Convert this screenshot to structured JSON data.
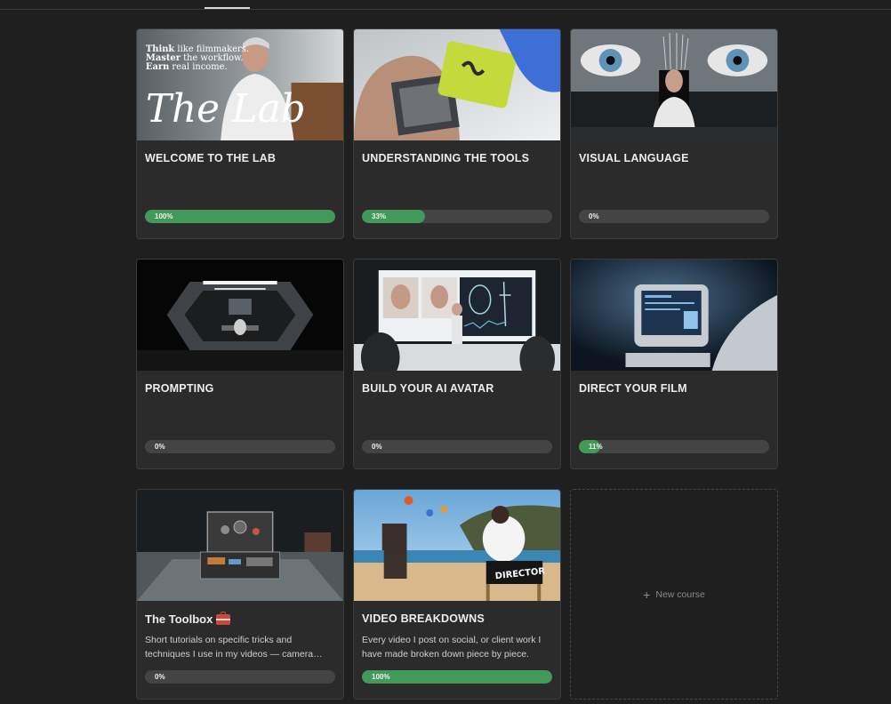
{
  "colors": {
    "background": "#1f1f1f",
    "card": "#2b2b2b",
    "progress_track": "#444444",
    "progress_fill": "#43995a"
  },
  "thumb_text": {
    "lab_line1_bold": "Think",
    "lab_line1_rest": " like filmmakers.",
    "lab_line2_bold": "Master",
    "lab_line2_rest": " the workflow.",
    "lab_line3_bold": "Earn",
    "lab_line3_rest": " real income.",
    "lab_script": "The Lab",
    "director_chair": "DIRECTOR"
  },
  "courses": [
    {
      "title": "WELCOME TO THE LAB",
      "description": "",
      "progress": 100,
      "progress_label": "100%"
    },
    {
      "title": "UNDERSTANDING THE TOOLS",
      "description": "",
      "progress": 33,
      "progress_label": "33%"
    },
    {
      "title": "VISUAL LANGUAGE",
      "description": "",
      "progress": 0,
      "progress_label": "0%"
    },
    {
      "title": "PROMPTING",
      "description": "",
      "progress": 0,
      "progress_label": "0%"
    },
    {
      "title": "BUILD YOUR AI AVATAR",
      "description": "",
      "progress": 0,
      "progress_label": "0%"
    },
    {
      "title": "DIRECT YOUR FILM",
      "description": "",
      "progress": 11,
      "progress_label": "11%"
    },
    {
      "title": "The Toolbox",
      "description": "Short tutorials on specific tricks and techniques I use in my videos — camera…",
      "progress": 0,
      "progress_label": "0%"
    },
    {
      "title": "VIDEO BREAKDOWNS",
      "description": "Every video I post on social, or client work I have made broken down piece by piece. Th…",
      "progress": 100,
      "progress_label": "100%"
    }
  ],
  "new_course": {
    "icon": "plus-icon",
    "label": "New course"
  }
}
